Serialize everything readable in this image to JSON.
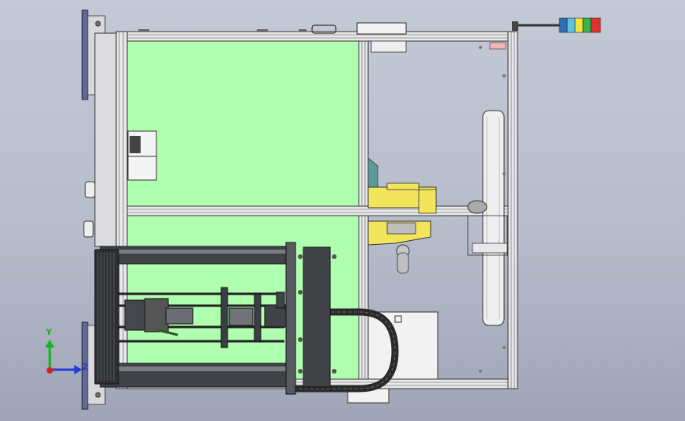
{
  "viewport": {
    "background_top": "#c4c9d6",
    "background_bottom": "#9fa5b7"
  },
  "triad": {
    "y_label": "Y",
    "z_label": "Z",
    "y_color": "#17b51d",
    "x_color": "#2a3bd8",
    "origin_color": "#d42020"
  },
  "colors": {
    "frame_profile": "#e8e8ea",
    "green_panel": "#b0ffb0",
    "robot_yellow": "#f2e55c",
    "cylinder_dark": "#3f4246",
    "side_plate_blue": "#5f6a9a",
    "signal_tower": [
      "#2b6fb3",
      "#5ec1e0",
      "#f0e63a",
      "#3ab54a",
      "#e03030"
    ]
  }
}
